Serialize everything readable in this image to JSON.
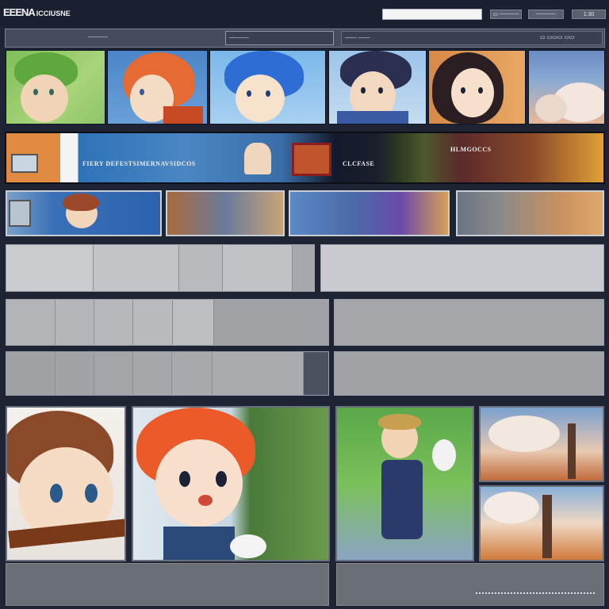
{
  "app": {
    "logo_main": "EEENA",
    "logo_sub": "ICCIUSNE"
  },
  "header": {
    "search_placeholder": "",
    "buttons": [
      "▭ ─────",
      "─────",
      "1:30"
    ]
  },
  "toolbar": {
    "items": [
      "─────",
      "─────",
      "─── ───",
      "▭ ▭▭▭ ▭▭"
    ]
  },
  "banner": {
    "text_left": "FIERY DEFESTSIMERNAVSIDCOS",
    "text_mid": "CLCFASE",
    "text_right": "HLMGOCCS"
  },
  "colors": {
    "background": "#1e2433",
    "panel_light": "#c9cbcf",
    "panel_mid": "#a6a8ac",
    "panel_dark": "#8e9094",
    "footer": "#6a6e76"
  },
  "icons": [
    "menu-icon",
    "search-icon",
    "settings-icon"
  ]
}
